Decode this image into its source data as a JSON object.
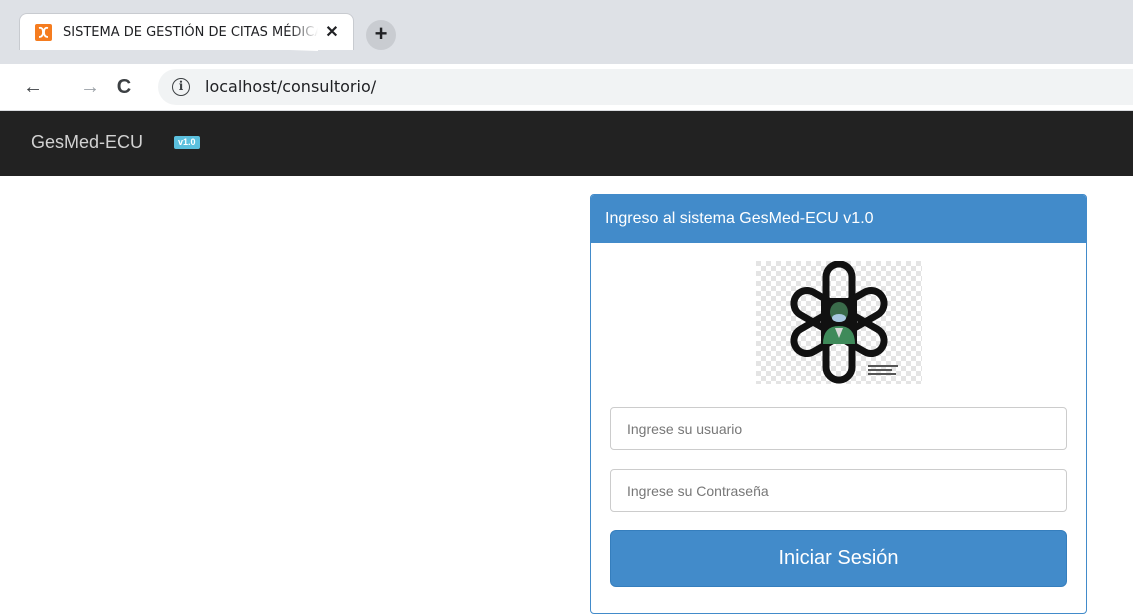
{
  "browser": {
    "tab_title": "SISTEMA DE GESTIÓN DE CITAS MÉDICAS",
    "tab_close": "✕",
    "new_tab": "+",
    "url": "localhost/consultorio/",
    "favicon_color": "#f57c1f"
  },
  "navbar": {
    "brand": "GesMed-ECU",
    "badge": "v1.0",
    "background": "#222222"
  },
  "login": {
    "heading": "Ingreso al sistema GesMed-ECU v1.0",
    "logo_icon": "medical-star-of-life-doctor-logo",
    "username_placeholder": "Ingrese su usuario",
    "password_placeholder": "Ingrese su Contraseña",
    "submit_label": "Iniciar Sesión",
    "accent": "#428bca"
  }
}
